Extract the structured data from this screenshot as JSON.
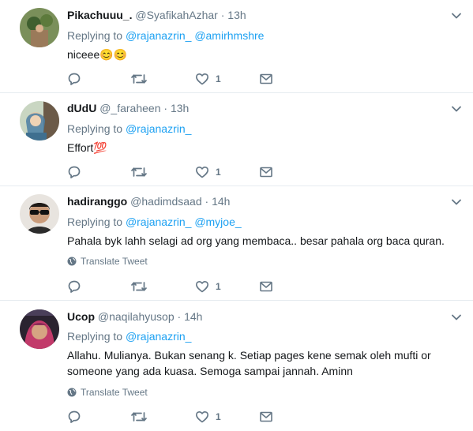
{
  "tweets": [
    {
      "name": "Pikachuuu_.",
      "handle": "@SyafikahAzhar",
      "sep": "·",
      "time": "13h",
      "replying_prefix": "Replying to",
      "mentions": [
        "@rajanazrin_",
        "@amirhmshre"
      ],
      "text": "niceee😊😊",
      "translate": "",
      "like_count": "1",
      "avatar_icon": "avatar-photo"
    },
    {
      "name": "dUdU",
      "handle": "@_faraheen",
      "sep": "·",
      "time": "13h",
      "replying_prefix": "Replying to",
      "mentions": [
        "@rajanazrin_"
      ],
      "text": "Effort💯",
      "translate": "",
      "like_count": "1",
      "avatar_icon": "avatar-photo"
    },
    {
      "name": "hadiranggo",
      "handle": "@hadimdsaad",
      "sep": "·",
      "time": "14h",
      "replying_prefix": "Replying to",
      "mentions": [
        "@rajanazrin_",
        "@myjoe_"
      ],
      "text": "Pahala byk lahh selagi ad org yang membaca.. besar pahala org baca quran.",
      "translate": "Translate Tweet",
      "like_count": "1",
      "avatar_icon": "avatar-photo"
    },
    {
      "name": "Ucop",
      "handle": "@naqilahyusop",
      "sep": "·",
      "time": "14h",
      "replying_prefix": "Replying to",
      "mentions": [
        "@rajanazrin_"
      ],
      "text_line1": "Allahu. Mulianya. Bukan senang k. Setiap pages kene semak oleh mufti or",
      "text_line2": "someone yang ada kuasa. Semoga sampai jannah. Aminn",
      "translate": "Translate Tweet",
      "like_count": "1",
      "avatar_icon": "avatar-photo"
    }
  ],
  "colors": {
    "link": "#1da1f2",
    "muted": "#657786",
    "text": "#14171a",
    "divider": "#e6ecf0"
  }
}
